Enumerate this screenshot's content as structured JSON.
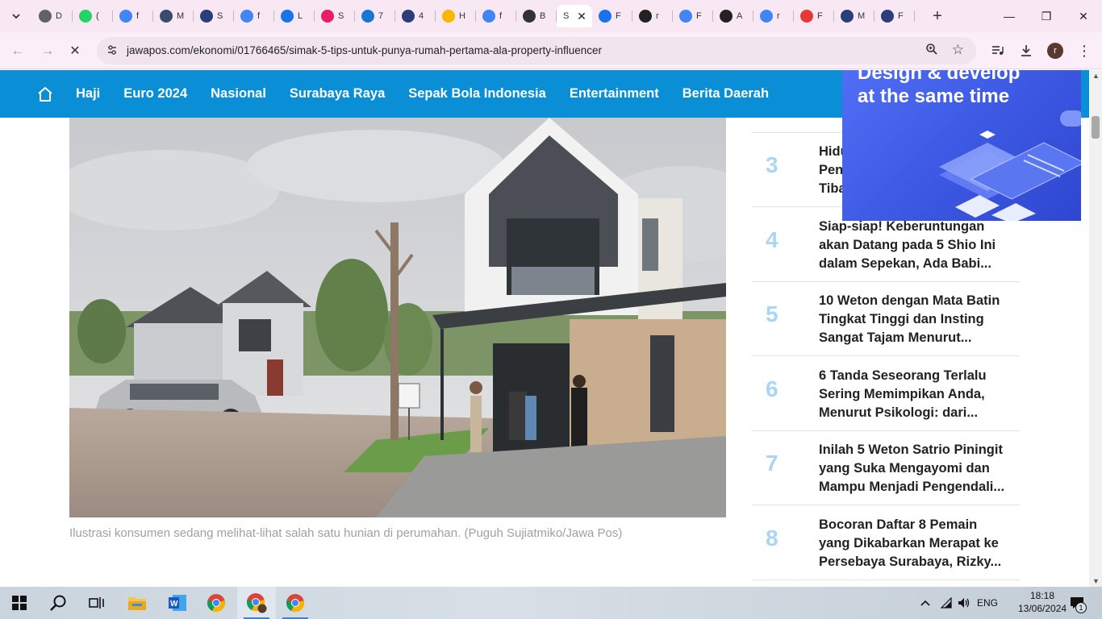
{
  "browser": {
    "tabs": [
      {
        "title": "D",
        "icon": "globe-icon",
        "color": "#5f6368"
      },
      {
        "title": "(",
        "icon": "whatsapp-icon",
        "color": "#25d366"
      },
      {
        "title": "f",
        "icon": "google-icon",
        "color": "#4285f4"
      },
      {
        "title": "M",
        "icon": "malwarebytes-icon",
        "color": "#3b4b6b"
      },
      {
        "title": "S",
        "icon": "bird-icon",
        "color": "#2a3f7a"
      },
      {
        "title": "f",
        "icon": "google-icon",
        "color": "#4285f4"
      },
      {
        "title": "L",
        "icon": "jp-icon",
        "color": "#1a73e8"
      },
      {
        "title": "S",
        "icon": "target-icon",
        "color": "#e91e63"
      },
      {
        "title": "7",
        "icon": "map-pin-icon",
        "color": "#1976d2"
      },
      {
        "title": "4",
        "icon": "bird-icon",
        "color": "#2a3f7a"
      },
      {
        "title": "H",
        "icon": "coin-icon",
        "color": "#f5b700"
      },
      {
        "title": "f",
        "icon": "google-icon",
        "color": "#4285f4"
      },
      {
        "title": "B",
        "icon": "speaker-icon",
        "color": "#333333"
      },
      {
        "title": "S",
        "icon": "close-icon",
        "color": "#333333",
        "active": true
      },
      {
        "title": "F",
        "icon": "jp-icon",
        "color": "#1a73e8"
      },
      {
        "title": "r",
        "icon": "io-icon",
        "color": "#222222"
      },
      {
        "title": "F",
        "icon": "google-icon",
        "color": "#4285f4"
      },
      {
        "title": "A",
        "icon": "io-icon",
        "color": "#222222"
      },
      {
        "title": "r",
        "icon": "google-icon",
        "color": "#4285f4"
      },
      {
        "title": "F",
        "icon": "opera-icon",
        "color": "#e53935"
      },
      {
        "title": "M",
        "icon": "bird-icon",
        "color": "#2a3f7a"
      },
      {
        "title": "F",
        "icon": "bird-icon",
        "color": "#2a3f7a"
      }
    ],
    "url": "jawapos.com/ekonomi/01766465/simak-5-tips-untuk-punya-rumah-pertama-ala-property-influencer",
    "profile_initial": "r"
  },
  "site": {
    "nav_items": [
      "Haji",
      "Euro 2024",
      "Nasional",
      "Surabaya Raya",
      "Sepak Bola Indonesia",
      "Entertainment",
      "Berita Daerah"
    ],
    "caption": "Ilustrasi konsumen sedang melihat-lihat salah satu hunian di perumahan. (Puguh Sujiatmiko/Jawa Pos)",
    "partial_item_tail": "ka",
    "trending": [
      {
        "num": "3",
        "lines": [
          "Hidup",
          "Pen",
          "Tiba"
        ]
      },
      {
        "num": "4",
        "lines": [
          "Siap-siap! Keberuntungan",
          "akan Datang pada 5 Shio Ini",
          "dalam Sepekan, Ada Babi..."
        ]
      },
      {
        "num": "5",
        "lines": [
          "10 Weton dengan Mata Batin",
          "Tingkat Tinggi dan Insting",
          "Sangat Tajam Menurut..."
        ]
      },
      {
        "num": "6",
        "lines": [
          "6 Tanda Seseorang Terlalu",
          "Sering Memimpikan Anda,",
          "Menurut Psikologi: dari..."
        ]
      },
      {
        "num": "7",
        "lines": [
          "Inilah 5 Weton Satrio Piningit",
          "yang Suka Mengayomi dan",
          "Mampu Menjadi Pengendali..."
        ]
      },
      {
        "num": "8",
        "lines": [
          "Bocoran Daftar 8 Pemain",
          "yang Dikabarkan Merapat ke",
          "Persebaya Surabaya, Rizky..."
        ]
      }
    ],
    "ad": {
      "line1": "Design & develop",
      "line2": "at the same time"
    },
    "brand_color": "#0a8fd6"
  },
  "taskbar": {
    "apps": [
      "start-icon",
      "search-icon",
      "task-view-icon",
      "file-explorer-icon",
      "word-icon",
      "chrome-icon",
      "chrome-profile-icon",
      "chrome-icon"
    ],
    "lang": "ENG",
    "time": "18:18",
    "date": "13/06/2024",
    "notifications": "1"
  }
}
